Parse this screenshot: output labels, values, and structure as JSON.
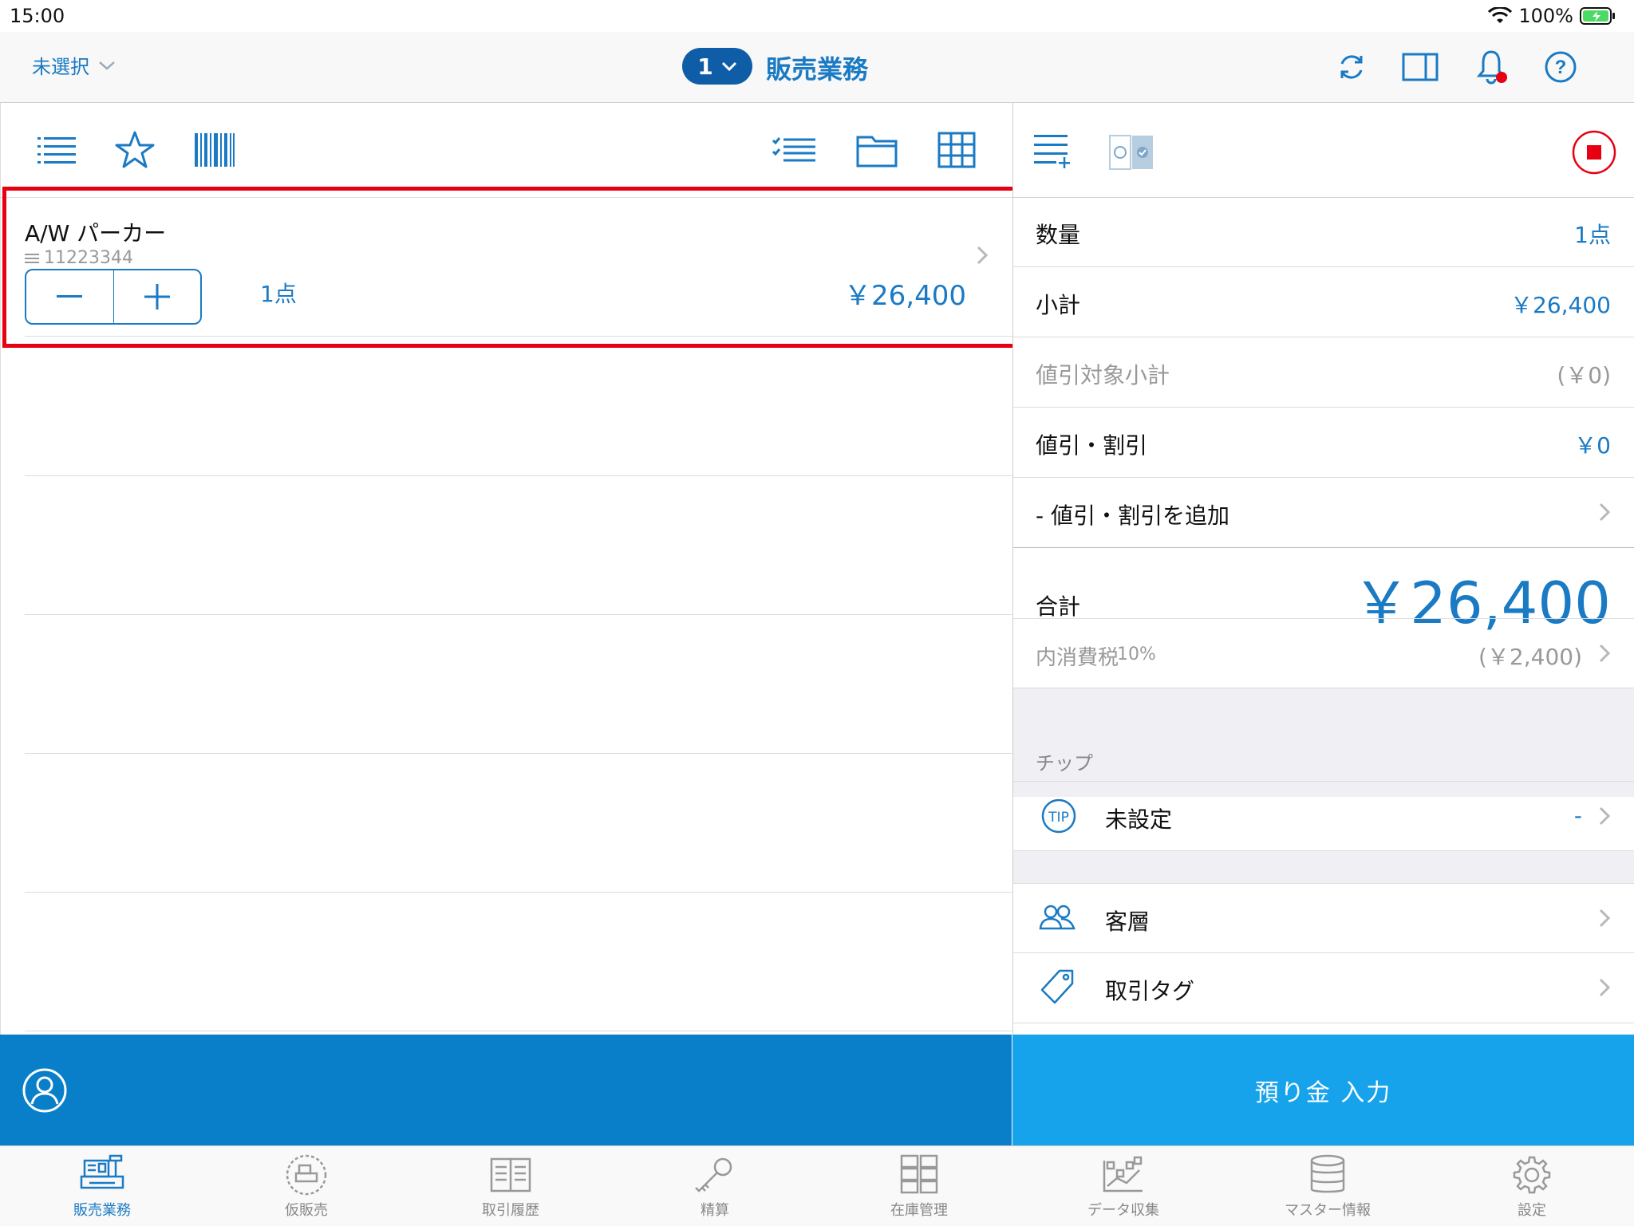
{
  "status_bar": {
    "time": "15:00",
    "battery": "100%"
  },
  "header": {
    "store_select": "未選択",
    "register_number": "1",
    "title": "販売業務"
  },
  "cart": {
    "items": [
      {
        "name": "A/W パーカー",
        "code": "11223344",
        "quantity": "1点",
        "price": "￥26,400"
      }
    ]
  },
  "summary": {
    "quantity_label": "数量",
    "quantity_value": "1点",
    "subtotal_label": "小計",
    "subtotal_value": "￥26,400",
    "discountable_label": "値引対象小計",
    "discountable_value": "(￥0)",
    "discount_label": "値引・割引",
    "discount_value": "￥0",
    "add_discount_label": "- 値引・割引を追加",
    "total_label": "合計",
    "total_value": "￥26,400",
    "tax_label": "内消費税",
    "tax_rate": "10%",
    "tax_value": "(￥2,400)"
  },
  "tip": {
    "section_label": "チップ",
    "icon_text": "TIP",
    "label": "未設定",
    "value": "-"
  },
  "customer_segment": {
    "label": "客層"
  },
  "transaction_tag": {
    "label": "取引タグ"
  },
  "deposit_button": {
    "label": "預り金 入力"
  },
  "tabs": [
    {
      "label": "販売業務",
      "icon": "register-icon",
      "active": true
    },
    {
      "label": "仮販売",
      "icon": "temp-sale-icon",
      "active": false
    },
    {
      "label": "取引履歴",
      "icon": "history-icon",
      "active": false
    },
    {
      "label": "精算",
      "icon": "key-icon",
      "active": false
    },
    {
      "label": "在庫管理",
      "icon": "inventory-icon",
      "active": false
    },
    {
      "label": "データ収集",
      "icon": "data-collection-icon",
      "active": false
    },
    {
      "label": "マスター情報",
      "icon": "database-icon",
      "active": false
    },
    {
      "label": "設定",
      "icon": "gear-icon",
      "active": false
    }
  ],
  "colors": {
    "accent": "#1a7ac4",
    "header_pill": "#0f5da7",
    "left_footer": "#0a7fc9",
    "deposit_button": "#17a3ec",
    "highlight": "#e60012"
  }
}
